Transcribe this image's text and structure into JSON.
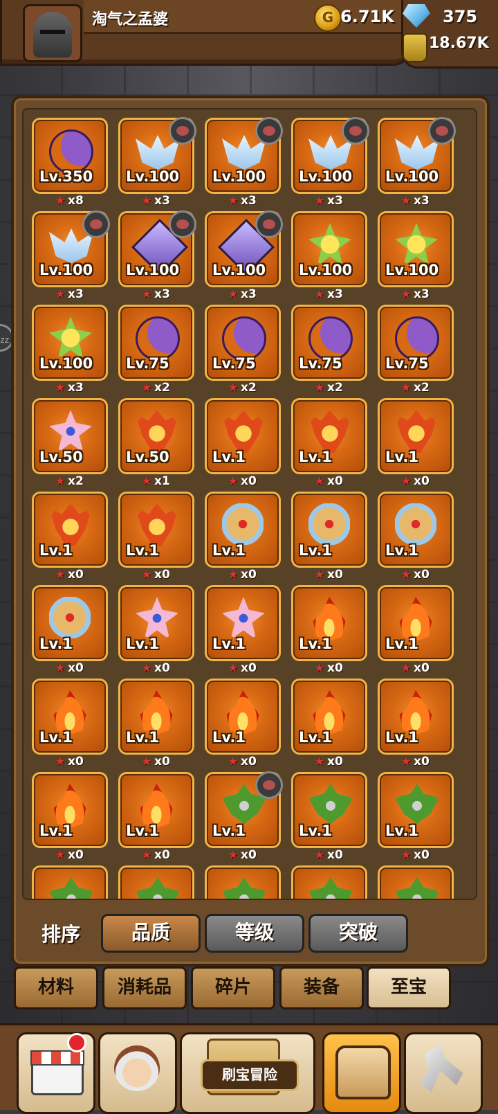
{
  "header": {
    "player_name": "淘气之孟婆",
    "gold": "6.71K",
    "gems": "375",
    "potion": "18.67K",
    "coin_icon": "G",
    "gold_color": "#f0b82a",
    "gem_color": "#5fb6e8"
  },
  "side_button": {
    "label": "zz"
  },
  "artifacts": [
    {
      "icon": "moon",
      "level": "Lv.350",
      "count": "x8",
      "badge": false
    },
    {
      "icon": "wing",
      "level": "Lv.100",
      "count": "x3",
      "badge": true
    },
    {
      "icon": "wing",
      "level": "Lv.100",
      "count": "x3",
      "badge": true
    },
    {
      "icon": "wing",
      "level": "Lv.100",
      "count": "x3",
      "badge": true
    },
    {
      "icon": "wing",
      "level": "Lv.100",
      "count": "x3",
      "badge": true
    },
    {
      "icon": "wing",
      "level": "Lv.100",
      "count": "x3",
      "badge": true
    },
    {
      "icon": "spear",
      "level": "Lv.100",
      "count": "x3",
      "badge": true
    },
    {
      "icon": "spear",
      "level": "Lv.100",
      "count": "x3",
      "badge": true
    },
    {
      "icon": "flower-y",
      "level": "Lv.100",
      "count": "x3",
      "badge": false
    },
    {
      "icon": "flower-y",
      "level": "Lv.100",
      "count": "x3",
      "badge": false
    },
    {
      "icon": "flower-y",
      "level": "Lv.100",
      "count": "x3",
      "badge": false
    },
    {
      "icon": "moon",
      "level": "Lv.75",
      "count": "x2",
      "badge": false
    },
    {
      "icon": "moon",
      "level": "Lv.75",
      "count": "x2",
      "badge": false
    },
    {
      "icon": "moon",
      "level": "Lv.75",
      "count": "x2",
      "badge": false
    },
    {
      "icon": "moon",
      "level": "Lv.75",
      "count": "x2",
      "badge": false
    },
    {
      "icon": "flower-p",
      "level": "Lv.50",
      "count": "x2",
      "badge": false
    },
    {
      "icon": "helm",
      "level": "Lv.50",
      "count": "x1",
      "badge": false
    },
    {
      "icon": "helm",
      "level": "Lv.1",
      "count": "x0",
      "badge": false
    },
    {
      "icon": "helm",
      "level": "Lv.1",
      "count": "x0",
      "badge": false
    },
    {
      "icon": "helm",
      "level": "Lv.1",
      "count": "x0",
      "badge": false
    },
    {
      "icon": "helm",
      "level": "Lv.1",
      "count": "x0",
      "badge": false
    },
    {
      "icon": "helm",
      "level": "Lv.1",
      "count": "x0",
      "badge": false
    },
    {
      "icon": "shield",
      "level": "Lv.1",
      "count": "x0",
      "badge": false
    },
    {
      "icon": "shield",
      "level": "Lv.1",
      "count": "x0",
      "badge": false
    },
    {
      "icon": "shield",
      "level": "Lv.1",
      "count": "x0",
      "badge": false
    },
    {
      "icon": "shield",
      "level": "Lv.1",
      "count": "x0",
      "badge": false
    },
    {
      "icon": "flower-p",
      "level": "Lv.1",
      "count": "x0",
      "badge": false
    },
    {
      "icon": "flower-p",
      "level": "Lv.1",
      "count": "x0",
      "badge": false
    },
    {
      "icon": "fire",
      "level": "Lv.1",
      "count": "x0",
      "badge": false
    },
    {
      "icon": "fire",
      "level": "Lv.1",
      "count": "x0",
      "badge": false
    },
    {
      "icon": "fire",
      "level": "Lv.1",
      "count": "x0",
      "badge": false
    },
    {
      "icon": "fire",
      "level": "Lv.1",
      "count": "x0",
      "badge": false
    },
    {
      "icon": "fire",
      "level": "Lv.1",
      "count": "x0",
      "badge": false
    },
    {
      "icon": "fire",
      "level": "Lv.1",
      "count": "x0",
      "badge": false
    },
    {
      "icon": "fire",
      "level": "Lv.1",
      "count": "x0",
      "badge": false
    },
    {
      "icon": "fire",
      "level": "Lv.1",
      "count": "x0",
      "badge": false
    },
    {
      "icon": "fire",
      "level": "Lv.1",
      "count": "x0",
      "badge": false
    },
    {
      "icon": "leaf",
      "level": "Lv.1",
      "count": "x0",
      "badge": true
    },
    {
      "icon": "leaf",
      "level": "Lv.1",
      "count": "x0",
      "badge": false
    },
    {
      "icon": "leaf",
      "level": "Lv.1",
      "count": "x0",
      "badge": false
    },
    {
      "icon": "leaf",
      "level": "",
      "count": "",
      "badge": false
    },
    {
      "icon": "leaf",
      "level": "",
      "count": "",
      "badge": false
    },
    {
      "icon": "leaf",
      "level": "",
      "count": "",
      "badge": false
    },
    {
      "icon": "leaf",
      "level": "",
      "count": "",
      "badge": false
    },
    {
      "icon": "leaf",
      "level": "",
      "count": "",
      "badge": false
    }
  ],
  "sort": {
    "label": "排序",
    "buttons": [
      {
        "label": "品质",
        "active": true
      },
      {
        "label": "等级",
        "active": false
      },
      {
        "label": "突破",
        "active": false
      }
    ]
  },
  "tabs": [
    {
      "label": "材料",
      "active": false
    },
    {
      "label": "消耗品",
      "active": false
    },
    {
      "label": "碎片",
      "active": false
    },
    {
      "label": "装备",
      "active": false
    },
    {
      "label": "至宝",
      "active": true
    }
  ],
  "bottom_nav": [
    {
      "name": "shop",
      "icon": "shop-icon",
      "notification": true,
      "active": false
    },
    {
      "name": "hero",
      "icon": "hero-icon",
      "notification": false,
      "active": false
    },
    {
      "name": "adventure",
      "icon": "treasure-map-icon",
      "label": "刷宝冒险",
      "notification": false,
      "active": false
    },
    {
      "name": "bag",
      "icon": "backpack-icon",
      "notification": false,
      "active": true
    },
    {
      "name": "forge",
      "icon": "hammer-icon",
      "notification": false,
      "active": false
    }
  ]
}
